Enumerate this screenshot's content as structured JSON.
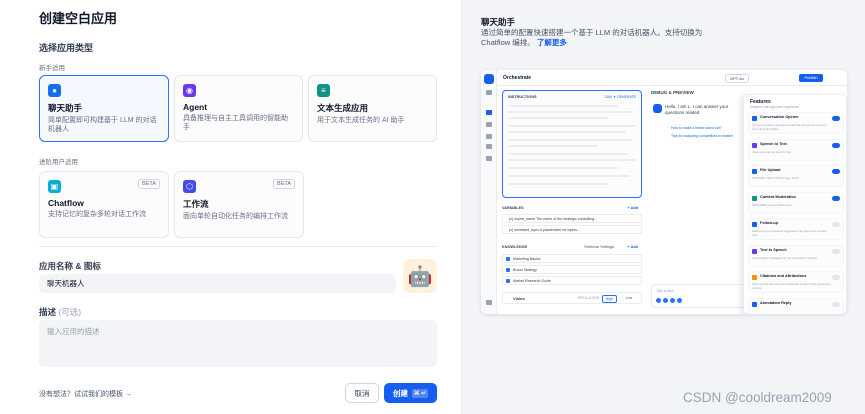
{
  "page": {
    "title": "创建空白应用",
    "section_type": "选择应用类型"
  },
  "groups": {
    "beginner": "新手适用",
    "advanced": "进阶用户适用"
  },
  "cards": [
    {
      "id": "chatbot",
      "icon": "chat-bubble-icon",
      "color": "#1570ef",
      "title": "聊天助手",
      "desc": "简单配置即可构建基于 LLM 的对话机器人",
      "selected": true
    },
    {
      "id": "agent",
      "icon": "agent-icon",
      "color": "#6938ef",
      "title": "Agent",
      "desc": "具备推理与自主工具调用的智能助手"
    },
    {
      "id": "textgen",
      "icon": "text-gen-icon",
      "color": "#0e9384",
      "title": "文本生成应用",
      "desc": "用于文本生成任务的 AI 助手"
    },
    {
      "id": "chatflow",
      "icon": "chatflow-icon",
      "color": "#06aed4",
      "title": "Chatflow",
      "desc": "支持记忆的复杂多轮对话工作流",
      "badge": "BETA"
    },
    {
      "id": "workflow",
      "icon": "workflow-icon",
      "color": "#444ce7",
      "title": "工作流",
      "desc": "面向单轮自动化任务的编排工作流",
      "badge": "BETA"
    }
  ],
  "form": {
    "name_label": "应用名称 & 图标",
    "name_value": "聊天机器人",
    "desc_label": "描述",
    "desc_optional": "(可选)",
    "desc_placeholder": "输入应用的描述"
  },
  "footer": {
    "template_link": "没有想法？试试我们的模板 →",
    "cancel": "取消",
    "create": "创建",
    "create_kbd": "⌘ ↵"
  },
  "right": {
    "title": "聊天助手",
    "desc": "通过简单的配置快速搭建一个基于 LLM 的对话机器人。支持切换为 Chatflow 编排。",
    "learn_more": "了解更多"
  },
  "preview": {
    "header_title": "Orchestrate",
    "model": "GPT-4o",
    "publish": "Publish",
    "instructions": "INSTRUCTIONS",
    "token_count": "2164",
    "generate": "✦ GENERATE",
    "variables": "VARIABLES",
    "add": "+ Add",
    "var_rows": [
      "{x} expert_name   The name of the strategic consulting...",
      "{x} unrelated_topic   A placeholder for topics..."
    ],
    "knowledge": "KNOWLEDGE",
    "retrieval": "Retrieval Settings",
    "knowledge_rows": [
      "Marketing Basics",
      "Brand Strategy",
      "Market Research Guide"
    ],
    "vision": "Vision",
    "resolution": "RESOLUTION",
    "high": "High",
    "low": "Low",
    "debug": "DEBUG & PREVIEW",
    "chat_greeting": "Hello, I am L. I can answer your questions related",
    "chat_links": [
      "How to make a brand stand out?",
      "Tips for analyzing competitors in market"
    ],
    "type_placeholder": "Talk to Bot",
    "features_title": "Features",
    "features_sub": "Enhance web app user experience",
    "features": [
      {
        "name": "Conversation Opener",
        "color": "#155eef",
        "on": true,
        "desc": "You are an entity consultant model that accepts an input text and output all entities."
      },
      {
        "name": "Speech to Text",
        "color": "#6938ef",
        "on": true,
        "desc": "Voice input can be used in chat"
      },
      {
        "name": "File Upload",
        "color": "#155eef",
        "on": true,
        "desc": "SUPPORT FILE TYPES Image, Docs"
      },
      {
        "name": "Content Moderation",
        "color": "#0e9384",
        "on": true,
        "desc": "PROVIDER OpenAI Moderation"
      },
      {
        "name": "Follow-up",
        "color": "#155eef",
        "on": false,
        "desc": "Setting up next questions suggestion can give users a better chat."
      },
      {
        "name": "Text to Speech",
        "color": "#6938ef",
        "on": false,
        "desc": "Conversation messages can be converted to speech"
      },
      {
        "name": "Citations and Attributions",
        "color": "#f79009",
        "on": false,
        "desc": "Show source document and attributed section of the generated content."
      },
      {
        "name": "Annotation Reply",
        "color": "#155eef",
        "on": false,
        "desc": ""
      }
    ]
  },
  "watermark": "CSDN @cooldream2009"
}
